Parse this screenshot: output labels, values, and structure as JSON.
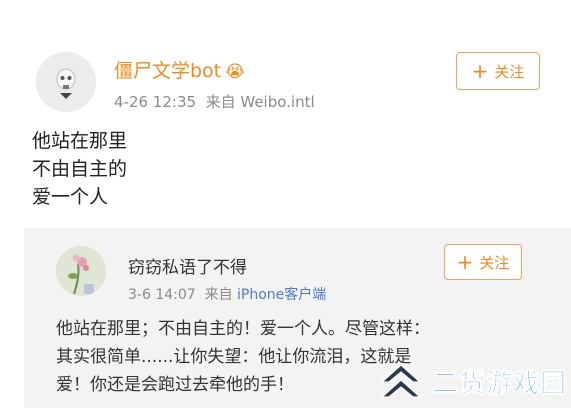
{
  "post": {
    "username": "僵尸文学bot",
    "badge_icon": "crying-face-icon",
    "timestamp": "4-26 12:35",
    "source": "来自 Weibo.intl",
    "follow_label": "关注",
    "content_lines": [
      "他站在那里",
      "不由自主的",
      "爱一个人"
    ]
  },
  "repost": {
    "username": "窃窃私语了不得",
    "timestamp": "3-6 14:07",
    "source_prefix": "来自 ",
    "source_link": "iPhone客户端",
    "follow_label": "关注",
    "content_lines": [
      "他站在那里；不由自主的！爱一个人。尽管这样：",
      "其实很简单......让你失望：他让你流泪，这就是",
      "爱！你还是会跑过去牵他的手！"
    ]
  },
  "watermark": {
    "text": "二货游戏园",
    "logo_icon": "double-chevron-logo-icon"
  },
  "colors": {
    "accent_orange": "#f08a1e",
    "link_blue": "#4a7bd0",
    "watermark_blue": "#2da5d8",
    "repost_bg": "#f3f3f3"
  }
}
